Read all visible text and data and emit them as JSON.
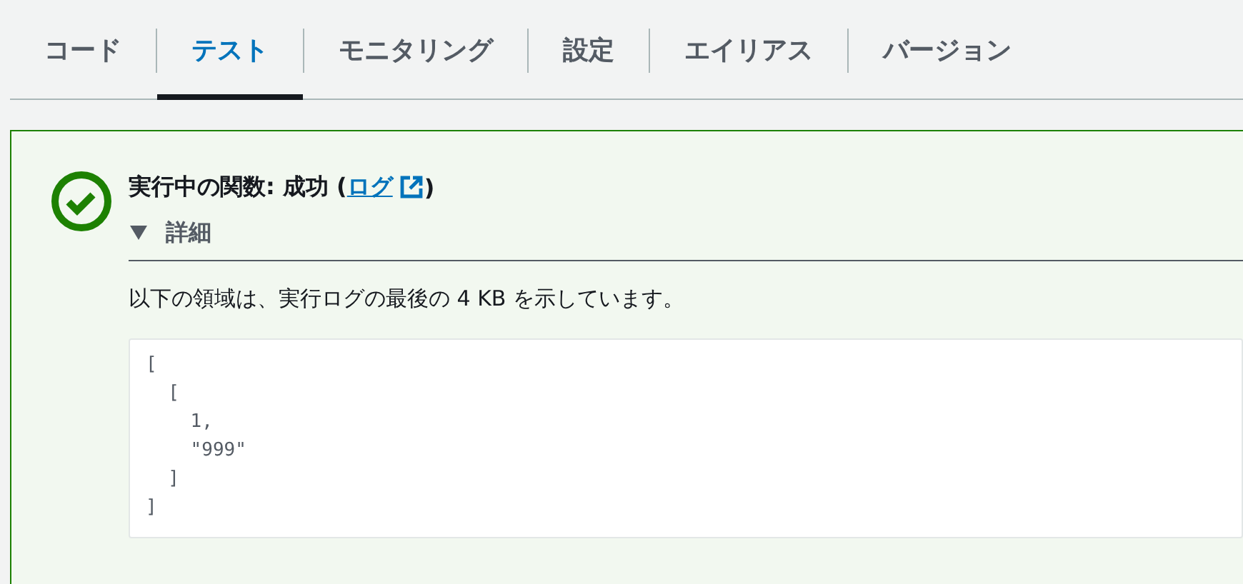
{
  "tabs": [
    {
      "label": "コード",
      "selected": false
    },
    {
      "label": "テスト",
      "selected": true
    },
    {
      "label": "モニタリング",
      "selected": false
    },
    {
      "label": "設定",
      "selected": false
    },
    {
      "label": "エイリアス",
      "selected": false
    },
    {
      "label": "バージョン",
      "selected": false
    }
  ],
  "result": {
    "kind": "success",
    "title_prefix": "実行中の関数: 成功 (",
    "link": "ログ",
    "title_suffix": ")",
    "details": {
      "label": "詳細",
      "expanded": true
    },
    "description": "以下の領域は、実行ログの最後の 4 KB を示しています。",
    "log": "[\n  [\n    1,\n    \"999\"\n  ]\n]"
  }
}
